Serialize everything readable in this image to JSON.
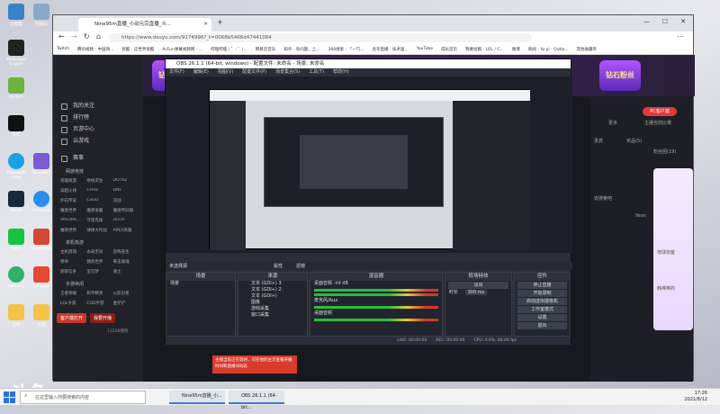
{
  "browser": {
    "tab_title": "Nine95m直播_小动元完直播_斗...",
    "url": "https://www.douyu.com/9174996?_t=0068b5466d47441084",
    "bookmarks": [
      "Twitch",
      "腾讯视频 - 中国领...",
      "优酷 - 这世界很酷",
      "AcFun弹幕视频网 - ...",
      "哔哩哔哩 ( ゜- ゜)...",
      "网易云音乐",
      "知乎 - 有问题，上...",
      "360搜索 - 「一勺...",
      "虎牙直播 - 技术驱...",
      "YouTube",
      "成长首页",
      "我要投稿 - LOL / C...",
      "微博",
      "新闻 - Yu yi - Outlo...",
      "其他收藏夹"
    ],
    "colors": {
      "accent": "#e2393b",
      "dark": "#18191f"
    }
  },
  "site": {
    "sidebar": {
      "items": [
        "我的关注",
        "排行榜",
        "页游中心",
        "云游戏"
      ],
      "games_label": "赛事",
      "hot_label": "网游竞技",
      "game_grid": [
        "英雄联盟",
        "绝地求生",
        "DOTA2",
        "穿越火线",
        "CFHD",
        "DNF",
        "炉石传说",
        "CSGO",
        "逆战",
        "魔兽世界",
        "魔兽争霸",
        "魔兽怀旧服",
        "VALORA...",
        "守望先锋",
        "DOTA",
        "魔兽世界",
        "球球大作战",
        "APEX英雄"
      ],
      "mobile_label": "单机热游",
      "mobile_grid": [
        "主机游戏",
        "永劫无间",
        "恐怖逃生",
        "原神",
        "我的世界",
        "拳击鬼魂",
        "刺客信条",
        "宝可梦",
        "骑士"
      ],
      "hand_label": "手游休闲",
      "hand_grid": [
        "王者荣耀",
        "和平精英",
        "火影忍者",
        "LOL手游",
        "COD手游",
        "金铲铲"
      ],
      "btn_open": "客户端打开",
      "btn_live": "我要开播",
      "count_label": "13338播物"
    },
    "banner_badge": "钻石粉丝",
    "right": {
      "pc_button": "PC客户端",
      "labels": [
        "主播当前比赛",
        "更多",
        "贵宾",
        "奖品(5)",
        "粉丝团(19)",
        "去搜索吧",
        "Yeon",
        "地球剑客",
        "韩棒棒的"
      ]
    }
  },
  "obs": {
    "title": "OBS 26.1.1 (64-bit, windows) - 配置文件: 未命名 - 场景: 未命名",
    "menu": [
      "文件(F)",
      "编辑(E)",
      "视图(V)",
      "配置文件(P)",
      "场景集合(S)",
      "工具(T)",
      "帮助(H)"
    ],
    "scene_bar": [
      "未选择源",
      "属性",
      "滤镜"
    ],
    "panels": {
      "scenes": {
        "title": "场景",
        "items": [
          "场景"
        ]
      },
      "sources": {
        "title": "来源",
        "items": [
          "文本 (GDI+) 3",
          "文本 (GDI+) 2",
          "文本 (GDI+)",
          "图像",
          "游戏采集",
          "窗口采集"
        ]
      },
      "mixer": {
        "title": "混音器",
        "items": [
          "桌面音频 -inf dB",
          "麦克风/Aux",
          "桌面音频"
        ]
      },
      "transitions": {
        "title": "转场特效",
        "type": "淡出",
        "duration_label": "时长",
        "duration": "300 ms"
      },
      "controls": {
        "title": "控件",
        "buttons": [
          "停止直播",
          "开始录制",
          "启动虚拟摄像机",
          "工作室模式",
          "设置",
          "退出"
        ]
      }
    },
    "status": [
      "LIVE: 00:00:00",
      "REC: 00:00:00",
      "CPU: 0.9%, 60.00 fps"
    ]
  },
  "notice": {
    "text": "主播当前正在等待，可在他的主页查看开播时间和直播间动态"
  },
  "taskbar": {
    "search_placeholder": "在这里输入你要搜索的内容",
    "tasks": [
      "Nine95m直播_小...",
      "OBS 26.1.1 (64-bit..."
    ],
    "time": "17:26",
    "date": "2021/8/12"
  },
  "desktop_icons": [
    "此电脑",
    "回收站",
    "Wallpaper Engine",
    "NVIDIA",
    "EPIC",
    "Microsoft Edge",
    "DELLWE3",
    "Steam",
    "Kookapp",
    "iQIYI",
    "ModOrgan",
    "qqmusic",
    "Bandizip",
    "文件",
    "文档"
  ],
  "watermark": "斗鱼"
}
